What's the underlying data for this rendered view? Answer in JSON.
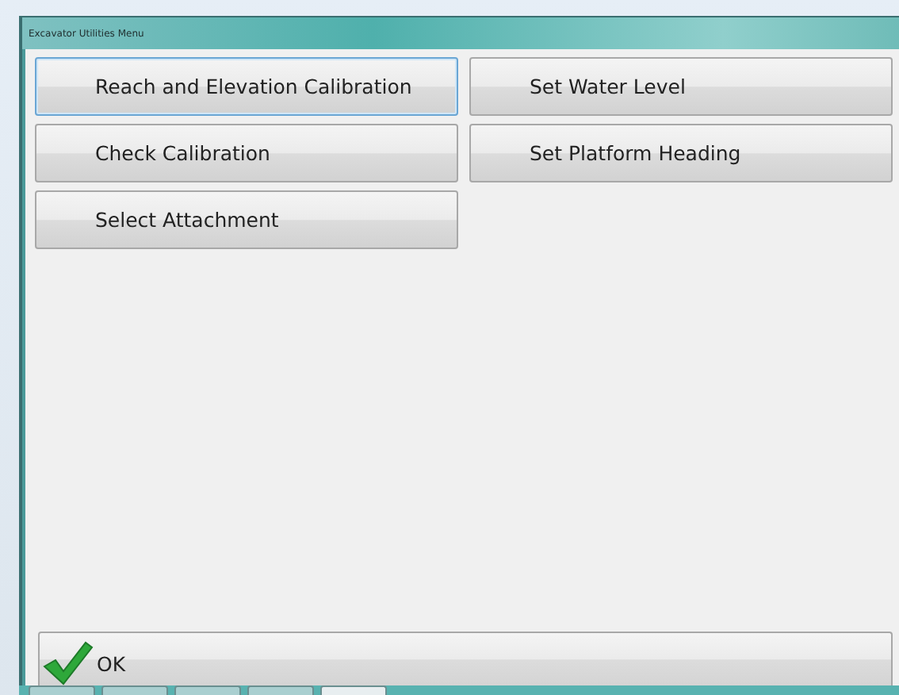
{
  "window": {
    "title": "Excavator Utilities Menu"
  },
  "menu_buttons": [
    {
      "label": "Reach and Elevation Calibration",
      "focused": true
    },
    {
      "label": "Set Water Level",
      "focused": false
    },
    {
      "label": "Check Calibration",
      "focused": false
    },
    {
      "label": "Set Platform Heading",
      "focused": false
    },
    {
      "label": "Select Attachment",
      "focused": false
    }
  ],
  "ok_button": {
    "label": "OK"
  }
}
